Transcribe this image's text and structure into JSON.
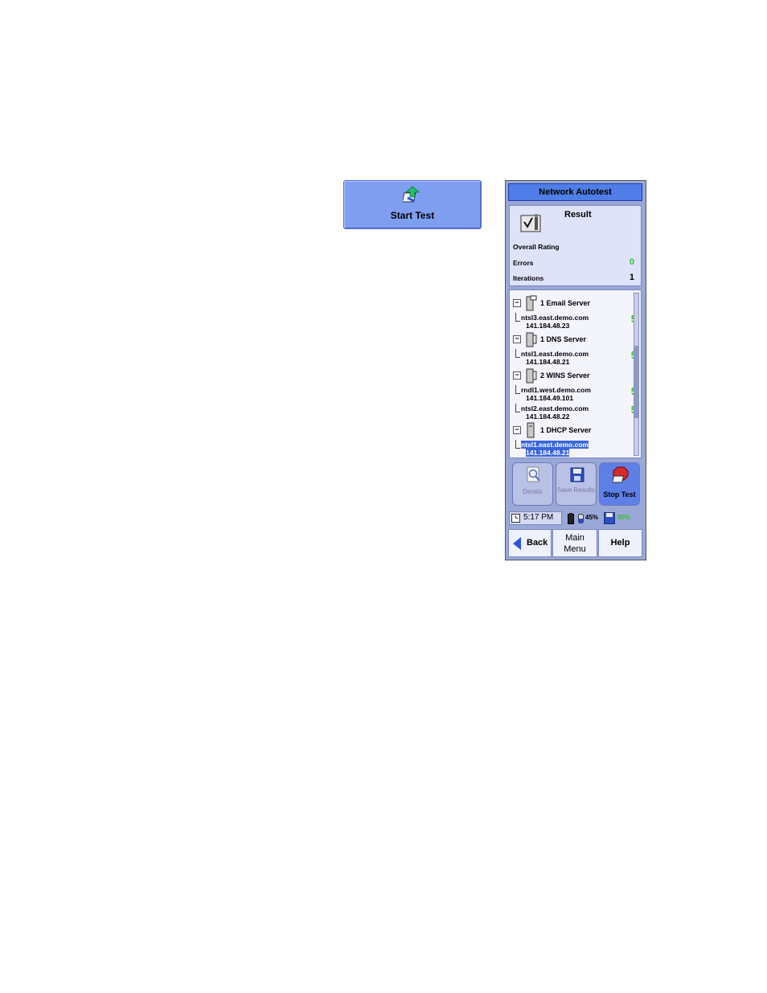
{
  "start_button": {
    "label": "Start Test",
    "icon": "start-test-icon"
  },
  "device": {
    "title": "Network Autotest",
    "result": {
      "title": "Result",
      "overall_rating_label": "Overall Rating",
      "errors_label": "Errors",
      "errors_value": "0",
      "iterations_label": "Iterations",
      "iterations_value": "1"
    },
    "tree": {
      "groups": [
        {
          "label": "1 Email Server",
          "toggle": "−",
          "icon": "email-server-icon",
          "nodes": [
            {
              "host": "ntsl3.east.demo.com",
              "ip": "141.184.48.23",
              "count": "5"
            }
          ]
        },
        {
          "label": "1 DNS Server",
          "toggle": "−",
          "icon": "dns-server-icon",
          "nodes": [
            {
              "host": "ntsl1.east.demo.com",
              "ip": "141.184.48.21",
              "count": "5"
            }
          ]
        },
        {
          "label": "2 WINS Server",
          "toggle": "−",
          "icon": "wins-server-icon",
          "nodes": [
            {
              "host": "rndl1.west.demo.com",
              "ip": "141.184.49.101",
              "count": "5"
            },
            {
              "host": "ntsl2.east.demo.com",
              "ip": "141.184.48.22",
              "count": "5"
            }
          ]
        },
        {
          "label": "1 DHCP Server",
          "toggle": "−",
          "icon": "dhcp-server-icon",
          "nodes": [
            {
              "host": "ntsl1.east.demo.com",
              "ip": "141.184.48.21",
              "count": ""
            }
          ]
        }
      ]
    },
    "actions": {
      "details": "Details",
      "save_results": "Save Results",
      "stop_test": "Stop Test"
    },
    "status": {
      "time": "5:17 PM",
      "memory": "45%",
      "disk": "50%"
    },
    "nav": {
      "back": "Back",
      "main_menu": "Main Menu",
      "help": "Help"
    }
  },
  "colors": {
    "accent": "#4f7ee8",
    "panel": "#9aa8d8",
    "ok_green": "#2fbf2f",
    "selection": "#3a64dc"
  }
}
